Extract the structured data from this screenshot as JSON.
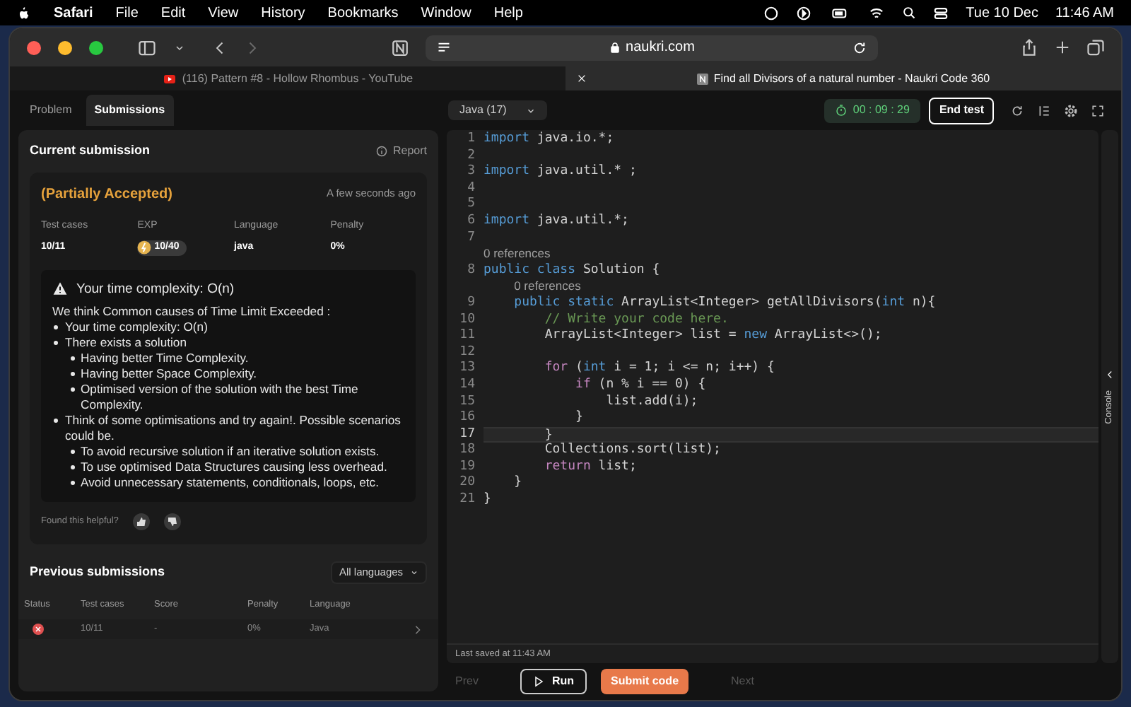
{
  "menu_bar": {
    "app": "Safari",
    "items": [
      "File",
      "Edit",
      "View",
      "History",
      "Bookmarks",
      "Window",
      "Help"
    ],
    "date": "Tue 10 Dec",
    "time": "11:46 AM"
  },
  "browser": {
    "address": "naukri.com",
    "tabs": [
      {
        "title": "(116) Pattern #8 - Hollow Rhombus - YouTube",
        "selected": false,
        "kind": "video"
      },
      {
        "title": "Find all Divisors of a natural number - Naukri Code 360",
        "selected": true,
        "kind": "site"
      }
    ]
  },
  "panel_tabs": [
    {
      "label": "Problem",
      "selected": false
    },
    {
      "label": "Submissions",
      "selected": true
    }
  ],
  "current_submission": {
    "title": "Current submission",
    "report": "Report",
    "status": "(Partially Accepted)",
    "when": "A few seconds ago",
    "stats": [
      {
        "label": "Test cases",
        "value": "10/11",
        "kind": "text"
      },
      {
        "label": "EXP",
        "value": "10/40",
        "kind": "badge"
      },
      {
        "label": "Language",
        "value": "java",
        "kind": "text"
      },
      {
        "label": "Penalty",
        "value": "0%",
        "kind": "text"
      }
    ],
    "feedback": {
      "heading": "Your time complexity: O(n)",
      "intro": "We think Common causes of Time Limit Exceeded :",
      "items": [
        {
          "text": "Your time complexity: O(n)"
        },
        {
          "text": "There exists a solution",
          "children": [
            {
              "text": "Having better Time Complexity."
            },
            {
              "text": "Having better Space Complexity."
            },
            {
              "text": "Optimised version of the solution with the best Time Complexity."
            }
          ]
        },
        {
          "text": "Think of some optimisations and try again!. Possible scenarios could be.",
          "children": [
            {
              "text": "To avoid recursive solution if an iterative solution exists."
            },
            {
              "text": "To use optimised Data Structures causing less overhead."
            },
            {
              "text": "Avoid unnecessary statements, conditionals, loops, etc."
            }
          ]
        }
      ]
    },
    "helpful": "Found this helpful?"
  },
  "previous_submissions": {
    "title": "Previous submissions",
    "filter": "All languages",
    "columns": [
      "Status",
      "Test cases",
      "Score",
      "Penalty",
      "Language"
    ],
    "rows": [
      {
        "passed": false,
        "test_cases": "10/11",
        "score": "-",
        "penalty": "0%",
        "language": "Java"
      }
    ]
  },
  "editor": {
    "language": "Java (17)",
    "timer": "00 : 09 : 29",
    "end_test": "End test",
    "console": "Console",
    "last_saved": "Last saved at 11:43 AM",
    "lines": [
      {
        "number": "1",
        "highlighted": false,
        "tokens": [
          {
            "kind": "keyword",
            "text": "import"
          },
          {
            "kind": "plain",
            "text": " java.io.*;"
          }
        ]
      },
      {
        "number": "2",
        "highlighted": false
      },
      {
        "number": "3",
        "highlighted": false,
        "tokens": [
          {
            "kind": "keyword",
            "text": "import"
          },
          {
            "kind": "plain",
            "text": " java.util.* ;"
          }
        ]
      },
      {
        "number": "4",
        "highlighted": false
      },
      {
        "number": "5",
        "highlighted": false
      },
      {
        "number": "6",
        "highlighted": false,
        "tokens": [
          {
            "kind": "keyword",
            "text": "import"
          },
          {
            "kind": "plain",
            "text": " java.util.*;"
          }
        ]
      },
      {
        "number": "7",
        "highlighted": false
      },
      {
        "number": "8",
        "highlighted": false,
        "lens": "0 references",
        "tokens": [
          {
            "kind": "keyword",
            "text": "public class"
          },
          {
            "kind": "plain",
            "text": " Solution {"
          }
        ]
      },
      {
        "number": "9",
        "highlighted": false,
        "lens": "0 references",
        "tokens": [
          {
            "kind": "keyword",
            "text": "    public static"
          },
          {
            "kind": "plain",
            "text": " ArrayList<Integer> getAllDivisors("
          },
          {
            "kind": "keyword",
            "text": "int"
          },
          {
            "kind": "plain",
            "text": " n){"
          }
        ]
      },
      {
        "number": "10",
        "highlighted": false,
        "tokens": [
          {
            "kind": "comment",
            "text": "        // Write your code here."
          }
        ]
      },
      {
        "number": "11",
        "highlighted": false,
        "tokens": [
          {
            "kind": "plain",
            "text": "        ArrayList<Integer> list = "
          },
          {
            "kind": "keyword",
            "text": "new"
          },
          {
            "kind": "plain",
            "text": " ArrayList<>();"
          }
        ]
      },
      {
        "number": "12",
        "highlighted": false
      },
      {
        "number": "13",
        "highlighted": false,
        "tokens": [
          {
            "kind": "control",
            "text": "        for"
          },
          {
            "kind": "plain",
            "text": " ("
          },
          {
            "kind": "keyword",
            "text": "int"
          },
          {
            "kind": "plain",
            "text": " i = 1; i <= n; i++) {"
          }
        ]
      },
      {
        "number": "14",
        "highlighted": false,
        "tokens": [
          {
            "kind": "control",
            "text": "            if"
          },
          {
            "kind": "plain",
            "text": " (n % i == 0) {"
          }
        ]
      },
      {
        "number": "15",
        "highlighted": false,
        "tokens": [
          {
            "kind": "plain",
            "text": "                list.add(i);"
          }
        ]
      },
      {
        "number": "16",
        "highlighted": false,
        "tokens": [
          {
            "kind": "plain",
            "text": "            }"
          }
        ]
      },
      {
        "number": "17",
        "highlighted": true,
        "tokens": [
          {
            "kind": "plain",
            "text": "        }"
          }
        ]
      },
      {
        "number": "18",
        "highlighted": false,
        "tokens": [
          {
            "kind": "plain",
            "text": "        Collections.sort(list);"
          }
        ]
      },
      {
        "number": "19",
        "highlighted": false,
        "tokens": [
          {
            "kind": "control",
            "text": "        return"
          },
          {
            "kind": "plain",
            "text": " list;"
          }
        ]
      },
      {
        "number": "20",
        "highlighted": false,
        "tokens": [
          {
            "kind": "plain",
            "text": "    }"
          }
        ]
      },
      {
        "number": "21",
        "highlighted": false,
        "tokens": [
          {
            "kind": "plain",
            "text": "}"
          }
        ]
      }
    ]
  },
  "footer": [
    {
      "label": "Prev",
      "kind": "nav",
      "disabled": true
    },
    {
      "label": "Run",
      "kind": "run",
      "disabled": false
    },
    {
      "label": "Submit code",
      "kind": "submit",
      "disabled": false
    },
    {
      "label": "Next",
      "kind": "nav",
      "disabled": true
    }
  ]
}
